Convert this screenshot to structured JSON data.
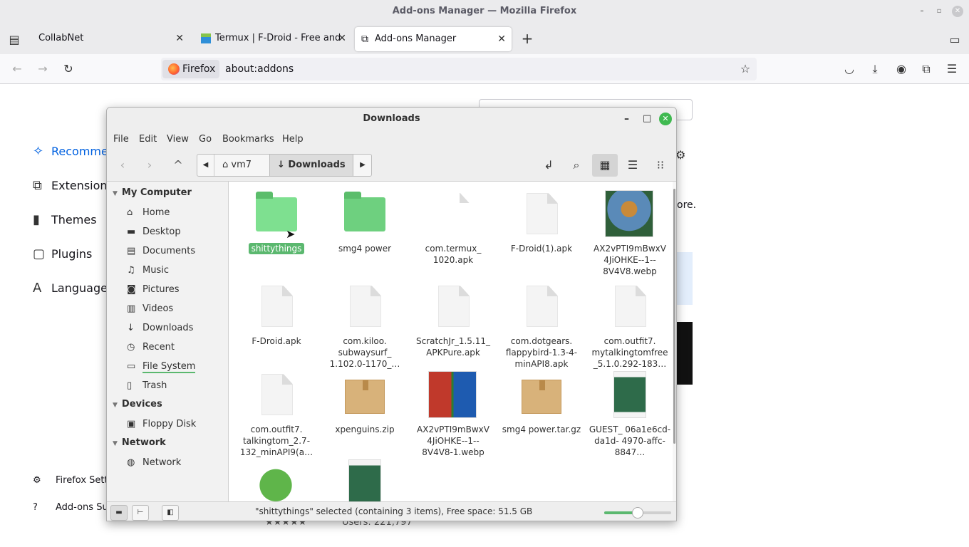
{
  "window": {
    "title": "Add-ons Manager — Mozilla Firefox"
  },
  "tabs": [
    {
      "label": "CollabNet"
    },
    {
      "label": "Termux | F-Droid - Free and"
    },
    {
      "label": "Add-ons Manager"
    }
  ],
  "urlbar": {
    "identity": "Firefox",
    "url": "about:addons"
  },
  "addons_sidebar": {
    "items": [
      "Recomme",
      "Extension",
      "Themes",
      "Plugins",
      "Language"
    ],
    "footer": [
      "Firefox Setti",
      "Add-ons Sup"
    ]
  },
  "addons_bg": {
    "more_text": "ore.",
    "users": "Users: 221,797"
  },
  "file_manager": {
    "title": "Downloads",
    "menu": [
      "File",
      "Edit",
      "View",
      "Go",
      "Bookmarks",
      "Help"
    ],
    "breadcrumb": [
      "vm7",
      "Downloads"
    ],
    "sidebar": {
      "my_computer": "My Computer",
      "places": [
        "Home",
        "Desktop",
        "Documents",
        "Music",
        "Pictures",
        "Videos",
        "Downloads",
        "Recent",
        "File System",
        "Trash"
      ],
      "devices": "Devices",
      "device_items": [
        "Floppy Disk"
      ],
      "network": "Network",
      "network_items": [
        "Network"
      ]
    },
    "files": [
      {
        "name": "shittythings",
        "type": "folder"
      },
      {
        "name": "smg4 power",
        "type": "folder"
      },
      {
        "name": "com.termux_ 1020.apk",
        "type": "doc"
      },
      {
        "name": "F-Droid(1).apk",
        "type": "doc"
      },
      {
        "name": "AX2vPTI9mBwxV 4JiOHKE--1-- 8V4V8.webp",
        "type": "image"
      },
      {
        "name": "F-Droid.apk",
        "type": "doc"
      },
      {
        "name": "com.kiloo. subwaysurf_ 1.102.0-1170_…",
        "type": "doc"
      },
      {
        "name": "ScratchJr_1.5.11_ APKPure.apk",
        "type": "doc"
      },
      {
        "name": "com.dotgears. flappybird-1.3-4- minAPI8.apk",
        "type": "doc"
      },
      {
        "name": "com.outfit7. mytalkingtomfree _5.1.0.292-183…",
        "type": "doc"
      },
      {
        "name": "com.outfit7. talkingtom_2.7- 132_minAPI9(a…",
        "type": "doc"
      },
      {
        "name": "xpenguins.zip",
        "type": "box"
      },
      {
        "name": "AX2vPTI9mBwxV 4JiOHKE--1-- 8V4V8-1.webp",
        "type": "image"
      },
      {
        "name": "smg4 power.tar.gz",
        "type": "box"
      },
      {
        "name": "GUEST_ 06a1e6cd-da1d- 4970-affc-8847…",
        "type": "image"
      }
    ],
    "status": "\"shittythings\" selected (containing 3 items), Free space: 51.5 GB",
    "zoom_level": 0.5
  },
  "colors": {
    "accent": "#5bb86f",
    "firefox_blue": "#0061e0",
    "close": "#3fb950"
  }
}
